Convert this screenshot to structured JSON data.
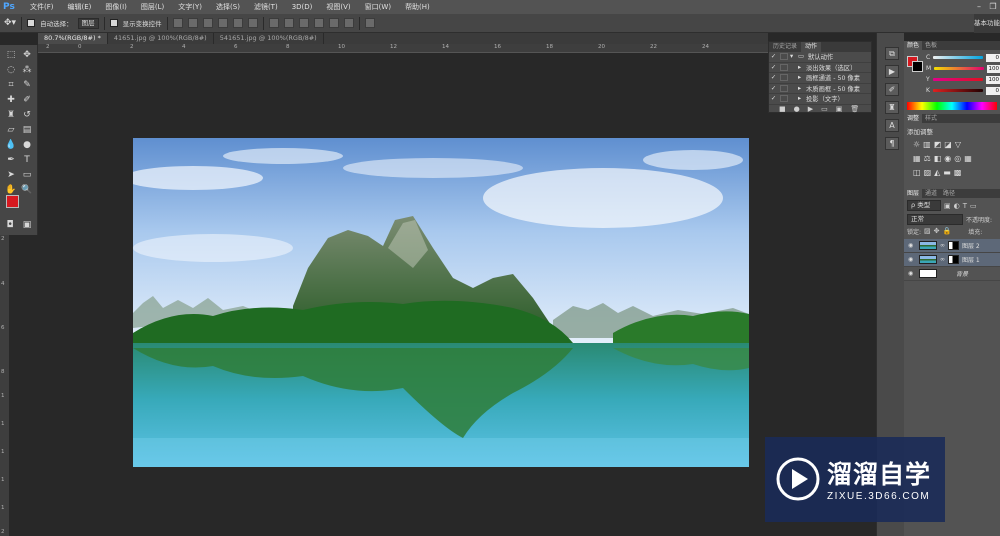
{
  "app": {
    "logo": "Ps"
  },
  "menu": [
    {
      "label": "文件(F)"
    },
    {
      "label": "编辑(E)"
    },
    {
      "label": "图像(I)"
    },
    {
      "label": "图层(L)"
    },
    {
      "label": "文字(Y)"
    },
    {
      "label": "选择(S)"
    },
    {
      "label": "滤镜(T)"
    },
    {
      "label": "3D(D)"
    },
    {
      "label": "视图(V)"
    },
    {
      "label": "窗口(W)"
    },
    {
      "label": "帮助(H)"
    }
  ],
  "window_controls": {
    "minimize": "–",
    "restore": "❐"
  },
  "options_bar": {
    "auto_select_label": "自动选择：",
    "auto_select_target": "图层",
    "show_transform_label": "显示变换控件",
    "workspace": "基本功能"
  },
  "tabs": [
    {
      "label": "80.7%(RGB/8#) *"
    },
    {
      "label": "41651.jpg @ 100%(RGB/8#)"
    },
    {
      "label": "541651.jpg @ 100%(RGB/8#)"
    }
  ],
  "ruler": {
    "top": [
      "2",
      "0",
      "2",
      "4",
      "6",
      "8",
      "10",
      "12",
      "14",
      "16",
      "18",
      "20",
      "22",
      "24"
    ],
    "left": [
      "2",
      "4",
      "6",
      "8",
      "1",
      "1",
      "1",
      "1",
      "1",
      "2"
    ]
  },
  "colors": {
    "foreground": "#d71920",
    "background": "#000000",
    "accent": "#4fa7ff",
    "selected_layer": "#5d6878",
    "watermark_bg": "#192a58"
  },
  "actions_panel": {
    "tabs": [
      {
        "label": "历史记录"
      },
      {
        "label": "动作"
      }
    ],
    "items": [
      {
        "label": "默认动作",
        "type": "folder"
      },
      {
        "label": "淡出效果（选区）",
        "type": "action"
      },
      {
        "label": "画框通道 - 50 像素",
        "type": "action"
      },
      {
        "label": "木质画框 - 50 像素",
        "type": "action"
      },
      {
        "label": "投影（文字）",
        "type": "action"
      }
    ]
  },
  "color_panel": {
    "tabs": [
      {
        "label": "颜色"
      },
      {
        "label": "色板"
      }
    ],
    "channels": [
      {
        "label": "C",
        "value": "0"
      },
      {
        "label": "M",
        "value": "100"
      },
      {
        "label": "Y",
        "value": "100"
      },
      {
        "label": "K",
        "value": "0"
      }
    ]
  },
  "adjustments_panel": {
    "tabs": [
      {
        "label": "调整"
      },
      {
        "label": "样式"
      }
    ],
    "title": "添加调整"
  },
  "layers_panel": {
    "tabs": [
      {
        "label": "图层"
      },
      {
        "label": "通道"
      },
      {
        "label": "路径"
      }
    ],
    "filter_label": "类型",
    "blend_mode": "正常",
    "opacity_label": "不透明度:",
    "lock_label": "锁定:",
    "fill_label": "填充:",
    "layers": [
      {
        "name": "图层 2",
        "selected": true,
        "has_mask": true
      },
      {
        "name": "图层 1",
        "selected": true,
        "has_mask": true
      },
      {
        "name": "背景",
        "selected": false,
        "has_mask": false
      }
    ]
  },
  "watermark": {
    "brand": "溜溜自学",
    "url": "ZIXUE.3D66.COM"
  }
}
